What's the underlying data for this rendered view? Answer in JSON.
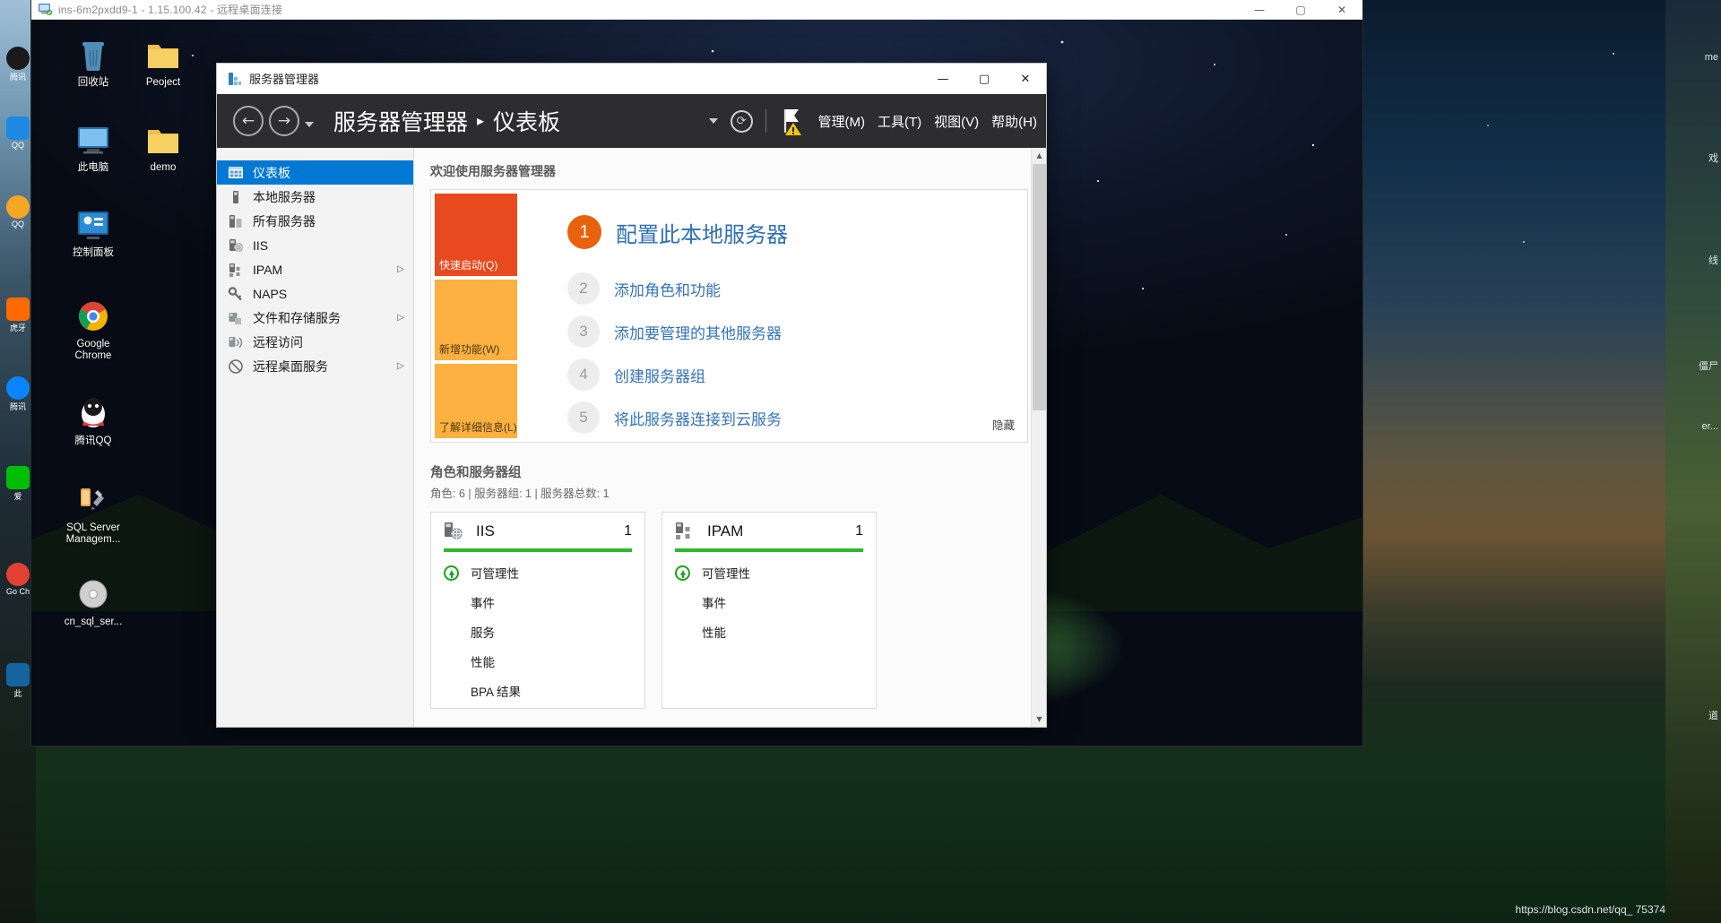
{
  "rdp": {
    "title": "ins-6m2pxdd9-1 - 1.15.100.42 - 远程桌面连接",
    "icon": "remote-desktop-icon",
    "buttons": {
      "minimize": "—",
      "maximize": "▢",
      "close": "✕"
    }
  },
  "guest_desktop": {
    "icons": [
      {
        "label": "回收站",
        "icon": "recycle-bin-icon"
      },
      {
        "label": "Peoject",
        "icon": "folder-icon"
      },
      {
        "label": "此电脑",
        "icon": "this-pc-icon"
      },
      {
        "label": "demo",
        "icon": "folder-icon"
      },
      {
        "label": "控制面板",
        "icon": "control-panel-icon"
      },
      {
        "label": "Google Chrome",
        "icon": "chrome-icon"
      },
      {
        "label": "腾讯QQ",
        "icon": "qq-icon"
      },
      {
        "label": "SQL Server Managem...",
        "icon": "sql-server-icon"
      },
      {
        "label": "cn_sql_ser...",
        "icon": "disc-image-icon"
      }
    ]
  },
  "host_desktop": {
    "icons": [
      {
        "label": "腾讯",
        "icon": "qq-icon"
      },
      {
        "label": "QQ",
        "icon": "qq-browser-icon"
      },
      {
        "label": "QQ",
        "icon": "qq-music-icon"
      },
      {
        "label": "虎牙",
        "icon": "huya-icon"
      },
      {
        "label": "腾讯",
        "icon": "tencent-icon"
      },
      {
        "label": "爱",
        "icon": "iqiyi-icon"
      },
      {
        "label": "Go Ch",
        "icon": "chrome-icon"
      },
      {
        "label": "此",
        "icon": "this-pc-icon"
      }
    ],
    "right_labels": [
      "me",
      "戏",
      "线",
      "僵尸",
      "er...",
      "道"
    ],
    "watermark": "https://blog.csdn.net/qq_ 75374"
  },
  "server_manager": {
    "window_title": "服务器管理器",
    "title_icon": "server-manager-icon",
    "window_buttons": {
      "minimize": "—",
      "maximize": "▢",
      "close": "✕"
    },
    "toolbar": {
      "back_icon": "arrow-left-icon",
      "forward_icon": "arrow-right-icon",
      "dropdown_icon": "chevron-down-icon",
      "breadcrumb_root": "服务器管理器",
      "breadcrumb_sep": "▸",
      "breadcrumb_current": "仪表板",
      "refresh_icon": "refresh-icon",
      "notification_icon": "flag-warning-icon",
      "menus": [
        {
          "label": "管理(M)"
        },
        {
          "label": "工具(T)"
        },
        {
          "label": "视图(V)"
        },
        {
          "label": "帮助(H)"
        }
      ]
    },
    "nav": {
      "items": [
        {
          "label": "仪表板",
          "icon": "dashboard-icon",
          "active": true,
          "expandable": false
        },
        {
          "label": "本地服务器",
          "icon": "local-server-icon",
          "active": false,
          "expandable": false
        },
        {
          "label": "所有服务器",
          "icon": "all-servers-icon",
          "active": false,
          "expandable": false
        },
        {
          "label": "IIS",
          "icon": "iis-icon",
          "active": false,
          "expandable": false
        },
        {
          "label": "IPAM",
          "icon": "ipam-icon",
          "active": false,
          "expandable": true
        },
        {
          "label": "NAPS",
          "icon": "naps-key-icon",
          "active": false,
          "expandable": false
        },
        {
          "label": "文件和存储服务",
          "icon": "file-storage-icon",
          "active": false,
          "expandable": true
        },
        {
          "label": "远程访问",
          "icon": "remote-access-icon",
          "active": false,
          "expandable": false
        },
        {
          "label": "远程桌面服务",
          "icon": "remote-desktop-services-icon",
          "active": false,
          "expandable": true
        }
      ],
      "expand_arrow": "▷"
    },
    "welcome": {
      "heading": "欢迎使用服务器管理器",
      "quick_strip": [
        {
          "label": "快速启动(Q)",
          "color": "#e8491e"
        },
        {
          "label": "新增功能(W)",
          "color": "#fbb040"
        },
        {
          "label": "了解详细信息(L)",
          "color": "#fbb040"
        }
      ],
      "steps": [
        {
          "num": "1",
          "label": "配置此本地服务器",
          "primary": true
        },
        {
          "num": "2",
          "label": "添加角色和功能",
          "primary": false
        },
        {
          "num": "3",
          "label": "添加要管理的其他服务器",
          "primary": false
        },
        {
          "num": "4",
          "label": "创建服务器组",
          "primary": false
        },
        {
          "num": "5",
          "label": "将此服务器连接到云服务",
          "primary": false
        }
      ],
      "hide_link": "隐藏"
    },
    "roles": {
      "title": "角色和服务器组",
      "summary": "角色: 6 | 服务器组: 1 | 服务器总数: 1",
      "tiles": [
        {
          "name": "IIS",
          "icon": "iis-icon",
          "count": "1",
          "status_color": "#2db92d",
          "rows": [
            {
              "label": "可管理性",
              "badge": true
            },
            {
              "label": "事件",
              "badge": false
            },
            {
              "label": "服务",
              "badge": false
            },
            {
              "label": "性能",
              "badge": false
            },
            {
              "label": "BPA 结果",
              "badge": false
            }
          ]
        },
        {
          "name": "IPAM",
          "icon": "ipam-icon",
          "count": "1",
          "status_color": "#2db92d",
          "rows": [
            {
              "label": "可管理性",
              "badge": true
            },
            {
              "label": "事件",
              "badge": false
            },
            {
              "label": "性能",
              "badge": false
            }
          ]
        }
      ]
    },
    "scrollbar": {
      "up": "▲",
      "down": "▼"
    }
  }
}
